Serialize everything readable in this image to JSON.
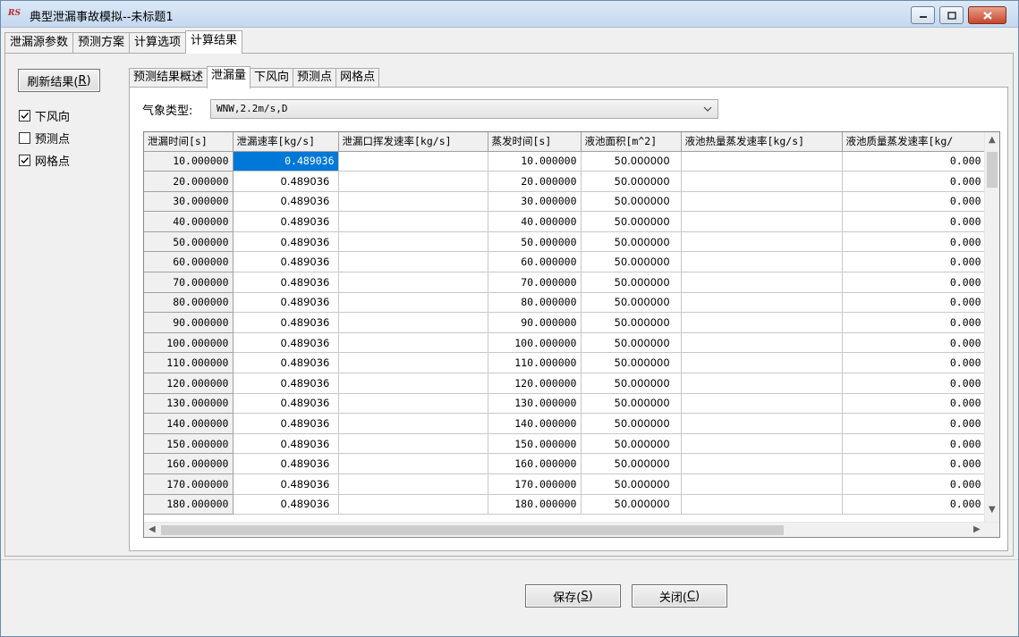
{
  "window": {
    "app_icon_text": "RS",
    "title": "典型泄漏事故模拟--未标题1"
  },
  "top_tabs": [
    {
      "label": "泄漏源参数",
      "active": false
    },
    {
      "label": "预测方案",
      "active": false
    },
    {
      "label": "计算选项",
      "active": false
    },
    {
      "label": "计算结果",
      "active": true
    }
  ],
  "left_panel": {
    "refresh_label": "刷新结果(",
    "refresh_key": "R",
    "refresh_close": ")",
    "checks": [
      {
        "label": "下风向",
        "checked": true
      },
      {
        "label": "预测点",
        "checked": false
      },
      {
        "label": "网格点",
        "checked": true
      }
    ]
  },
  "inner_tabs": [
    {
      "label": "预测结果概述",
      "active": false
    },
    {
      "label": "泄漏量",
      "active": true
    },
    {
      "label": "下风向",
      "active": false
    },
    {
      "label": "预测点",
      "active": false
    },
    {
      "label": "网格点",
      "active": false
    }
  ],
  "weather": {
    "label": "气象类型:",
    "value": "WNW,2.2m/s,D"
  },
  "table": {
    "columns": [
      "泄漏时间[s]",
      "泄漏速率[kg/s]",
      "泄漏口挥发速率[kg/s]",
      "蒸发时间[s]",
      "液池面积[m^2]",
      "液池热量蒸发速率[kg/s]",
      "液池质量蒸发速率[kg/"
    ],
    "rows": [
      [
        "10.000000",
        "0.489036",
        "",
        "10.000000",
        "50.000000",
        "",
        "0.000"
      ],
      [
        "20.000000",
        "0.489036",
        "",
        "20.000000",
        "50.000000",
        "",
        "0.000"
      ],
      [
        "30.000000",
        "0.489036",
        "",
        "30.000000",
        "50.000000",
        "",
        "0.000"
      ],
      [
        "40.000000",
        "0.489036",
        "",
        "40.000000",
        "50.000000",
        "",
        "0.000"
      ],
      [
        "50.000000",
        "0.489036",
        "",
        "50.000000",
        "50.000000",
        "",
        "0.000"
      ],
      [
        "60.000000",
        "0.489036",
        "",
        "60.000000",
        "50.000000",
        "",
        "0.000"
      ],
      [
        "70.000000",
        "0.489036",
        "",
        "70.000000",
        "50.000000",
        "",
        "0.000"
      ],
      [
        "80.000000",
        "0.489036",
        "",
        "80.000000",
        "50.000000",
        "",
        "0.000"
      ],
      [
        "90.000000",
        "0.489036",
        "",
        "90.000000",
        "50.000000",
        "",
        "0.000"
      ],
      [
        "100.000000",
        "0.489036",
        "",
        "100.000000",
        "50.000000",
        "",
        "0.000"
      ],
      [
        "110.000000",
        "0.489036",
        "",
        "110.000000",
        "50.000000",
        "",
        "0.000"
      ],
      [
        "120.000000",
        "0.489036",
        "",
        "120.000000",
        "50.000000",
        "",
        "0.000"
      ],
      [
        "130.000000",
        "0.489036",
        "",
        "130.000000",
        "50.000000",
        "",
        "0.000"
      ],
      [
        "140.000000",
        "0.489036",
        "",
        "140.000000",
        "50.000000",
        "",
        "0.000"
      ],
      [
        "150.000000",
        "0.489036",
        "",
        "150.000000",
        "50.000000",
        "",
        "0.000"
      ],
      [
        "160.000000",
        "0.489036",
        "",
        "160.000000",
        "50.000000",
        "",
        "0.000"
      ],
      [
        "170.000000",
        "0.489036",
        "",
        "170.000000",
        "50.000000",
        "",
        "0.000"
      ],
      [
        "180.000000",
        "0.489036",
        "",
        "180.000000",
        "50.000000",
        "",
        "0.000"
      ]
    ]
  },
  "buttons": {
    "save": "保存(",
    "save_key": "S",
    "close": "关闭(",
    "close_key": "C",
    "paren": ")"
  },
  "colors": {
    "selection": "#0078d7",
    "titlebar": "#c4d8ef",
    "close_button": "#c7452b"
  }
}
